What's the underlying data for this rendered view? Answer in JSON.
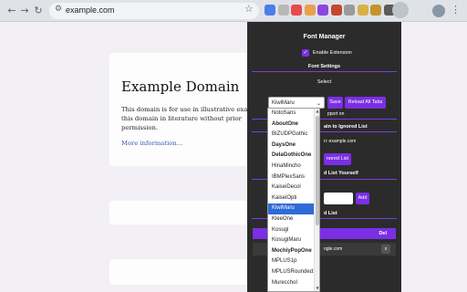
{
  "browser": {
    "url": "example.com",
    "back_icon": "arrow-left-icon",
    "forward_icon": "arrow-right-icon",
    "reload_icon": "reload-icon",
    "back_glyph": "←",
    "forward_glyph": "→",
    "reload_glyph": "↻",
    "site_glyph": "⚙",
    "star_glyph": "☆",
    "menu_glyph": "⋮",
    "extension_colors": [
      "#4a7ee8",
      "#b8b8b8",
      "#e84a4a",
      "#e8a14a",
      "#8e44e0",
      "#c6472f",
      "#9a9a9a",
      "#d8b04a",
      "#c4942a",
      "#5a5a5a",
      "#6b6b6b"
    ]
  },
  "page": {
    "heading": "Example Domain",
    "paragraph": "This domain is for use in illustrative exam use this domain in literature without prior permission.",
    "link": "More information..."
  },
  "popup": {
    "title": "Font Manager",
    "enable_label": "Enable Extension",
    "enable_checked": true,
    "check_glyph": "✓",
    "font_settings_title": "Font Settings",
    "select_label": "Select",
    "selected_font": "KiwiMaru",
    "chevron_glyph": "⌄",
    "save_label": "Save",
    "reload_all_label": "Reload All Tabs",
    "support_text": "pport on",
    "ignored_title": "ain to Ignored List",
    "domain_text": "n: example.com",
    "ignored_button": "nored List",
    "add_yourself_title": "d List Yourself",
    "add_label": "Add",
    "list_title": "d List",
    "del_label": "Del",
    "row_text": "ogle.com",
    "row_delete": "x",
    "accent_color": "#7b2fe4"
  },
  "dropdown": {
    "items": [
      {
        "label": "NotoSans",
        "selected": false,
        "bold": false
      },
      {
        "label": "AboutOne",
        "selected": false,
        "bold": true
      },
      {
        "label": "BIZUDPGothic",
        "selected": false,
        "bold": false
      },
      {
        "label": "DaysOne",
        "selected": false,
        "bold": true
      },
      {
        "label": "DelaGothicOne",
        "selected": false,
        "bold": true
      },
      {
        "label": "HinaMincho",
        "selected": false,
        "bold": false
      },
      {
        "label": "IBMPlexSans",
        "selected": false,
        "bold": false
      },
      {
        "label": "KaiseiDecol",
        "selected": false,
        "bold": false
      },
      {
        "label": "KaiseiOpti",
        "selected": false,
        "bold": false
      },
      {
        "label": "KiwiMaru",
        "selected": true,
        "bold": false
      },
      {
        "label": "KleeOne",
        "selected": false,
        "bold": false
      },
      {
        "label": "Kosugi",
        "selected": false,
        "bold": false
      },
      {
        "label": "KosugiMaru",
        "selected": false,
        "bold": false
      },
      {
        "label": "MochiyPopOne",
        "selected": false,
        "bold": true
      },
      {
        "label": "MPLUS1p",
        "selected": false,
        "bold": false
      },
      {
        "label": "MPLUSRounded1c",
        "selected": false,
        "bold": false
      },
      {
        "label": "MurecchoI",
        "selected": false,
        "bold": false
      }
    ],
    "selected_color": "#2f6bd6",
    "up_glyph": "▲",
    "down_glyph": "▼"
  }
}
